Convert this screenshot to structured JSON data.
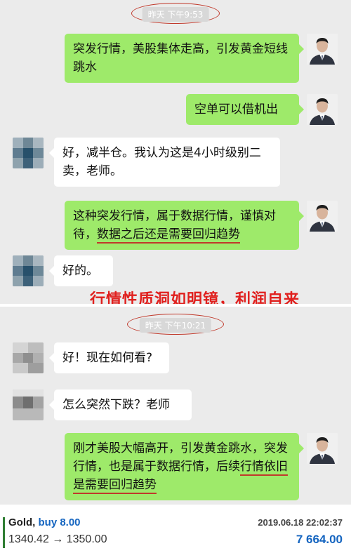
{
  "section1": {
    "timestamp": "昨天 下午9:53",
    "messages": [
      {
        "from": "teacher",
        "text": "突发行情，美股集体走高，引发黄金短线跳水"
      },
      {
        "from": "teacher",
        "text": "空单可以借机出"
      },
      {
        "from": "user",
        "text": "好，减半仓。我认为这是4小时级别二卖，老师。"
      },
      {
        "from": "teacher",
        "text_a": "这种突发行情，属于数据行情，谨慎对待，",
        "text_b": "数据之后还是需要回归趋势"
      },
      {
        "from": "user",
        "text": "好的。"
      }
    ]
  },
  "caption": "行情性质洞如明镜，利润自来",
  "section2": {
    "timestamp": "昨天 下午10:21",
    "messages": [
      {
        "from": "user",
        "text": "好！现在如何看?"
      },
      {
        "from": "user",
        "text": "怎么突然下跌？老师"
      },
      {
        "from": "teacher",
        "text_a": "刚才美股大幅高开，引发黄金跳水，突发行情，也是属于数据行情，后续",
        "text_b": "行情依旧是需要回归趋势"
      }
    ]
  },
  "trade": {
    "symbol": "Gold,",
    "action": "buy 8.00",
    "prices": "1340.42 → 1350.00",
    "datetime": "2019.06.18 22:02:37",
    "profit": "7 664.00"
  },
  "colors": {
    "chat_bg": "#ebebeb",
    "bubble_green": "#9eea6a",
    "bubble_white": "#ffffff",
    "highlight_red": "#e0201e",
    "profit_blue": "#1565c0",
    "buy_blue": "#1565c0"
  },
  "icons": {
    "teacher_avatar": "person-avatar-icon",
    "user_avatar": "blurred-avatar-icon"
  }
}
